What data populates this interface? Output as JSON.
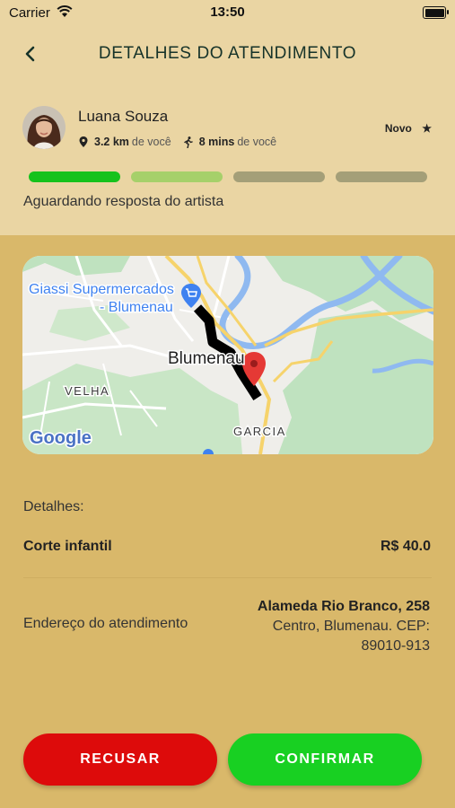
{
  "status_bar": {
    "carrier": "Carrier",
    "time": "13:50"
  },
  "header": {
    "title": "DETALHES DO ATENDIMENTO"
  },
  "artist": {
    "name": "Luana Souza",
    "distance_value": "3.2 km",
    "distance_suffix": "de você",
    "time_value": "8 mins",
    "time_suffix": "de você",
    "rating_label": "Novo",
    "rating_icon": "★"
  },
  "progress": {
    "steps": 4,
    "current": 1,
    "colors": [
      "#16c21c",
      "#a6d06a",
      "#a49f78",
      "#a49f78"
    ]
  },
  "status_text": "Aguardando resposta do artista",
  "map": {
    "poi": "Giassi Supermercados",
    "poi_line2": "- Blumenau",
    "city": "Blumenau",
    "district_left": "VELHA",
    "district_bottom": "GARCIA",
    "logo": "Google"
  },
  "details": {
    "label": "Detalhes:",
    "service": "Corte infantil",
    "price": "R$ 40.0"
  },
  "address": {
    "label": "Endereço do atendimento",
    "street": "Alameda Rio Branco, 258",
    "line2": "Centro, Blumenau. CEP:",
    "line3": "89010-913"
  },
  "actions": {
    "decline": "RECUSAR",
    "confirm": "CONFIRMAR"
  },
  "colors": {
    "accent_green": "#18d022",
    "decline_red": "#dd0b0b",
    "background": "#d9b86a",
    "header_bg": "#ead5a3"
  }
}
